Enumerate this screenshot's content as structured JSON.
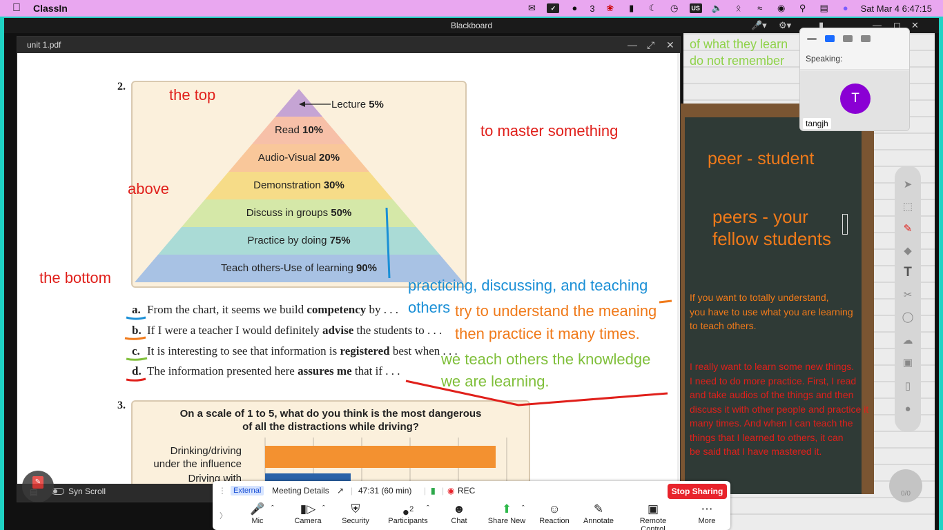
{
  "menubar": {
    "app_name": "ClassIn",
    "notifications_count": "3",
    "badge_count": "3",
    "input_source": "US",
    "datetime": "Sat Mar 4  6:47:15"
  },
  "window": {
    "title": "Blackboard"
  },
  "pdf": {
    "filename": "unit 1.pdf",
    "syn_scroll_label": "Syn Scroll",
    "q2_number": "2.",
    "q3_number": "3.",
    "pyramid_layers": [
      {
        "text": "Lecture ",
        "pct": "5%"
      },
      {
        "text": "Read ",
        "pct": "10%"
      },
      {
        "text": "Audio-Visual ",
        "pct": "20%"
      },
      {
        "text": "Demonstration ",
        "pct": "30%"
      },
      {
        "text": "Discuss in groups ",
        "pct": "50%"
      },
      {
        "text": "Practice by doing ",
        "pct": "75%"
      },
      {
        "text": "Teach others-Use of learning ",
        "pct": "90%"
      }
    ],
    "questions": [
      {
        "letter": "a.",
        "pre": "From the chart, it seems we build ",
        "bold": "competency",
        "post": " by . . ."
      },
      {
        "letter": "b.",
        "pre": "If I were a teacher I would definitely ",
        "bold": "advise",
        "post": " the students to . . ."
      },
      {
        "letter": "c.",
        "pre": "It is interesting to see that information is ",
        "bold": "registered",
        "post": " best when . . ."
      },
      {
        "letter": "d.",
        "pre": "The information presented here ",
        "bold": "assures me",
        "post": " that if . . ."
      }
    ],
    "chart": {
      "title_line1": "On a scale of 1 to 5, what do you think is the most dangerous",
      "title_line2": "of all the distractions while driving?",
      "cat1_line1": "Drinking/driving",
      "cat1_line2": "under the influence",
      "cat2_line1": "Driving with"
    },
    "annotations": {
      "the_top": "the top",
      "above": "above",
      "the_bottom": "the bottom",
      "to_master": "to master something",
      "practicing": "practicing, discussing, and teaching",
      "others": "others",
      "try_line1": "try to understand the meaning",
      "try_line2": "then practice it many times.",
      "we_teach_line1": "we teach others the knowledge",
      "we_teach_line2": "we are learning."
    }
  },
  "chart_data": {
    "type": "bar",
    "title": "On a scale of 1 to 5, what do you think is the most dangerous of all the distractions while driving?",
    "categories": [
      "Drinking/driving under the influence",
      "Driving with"
    ],
    "values": [
      5,
      2
    ],
    "xlim": [
      0,
      5
    ],
    "colors": [
      "#f39130",
      "#2a62a8"
    ]
  },
  "board": {
    "top_line1": "of what they learn",
    "top_line2": "do not remember",
    "peer": "peer - student",
    "peers_line1": "peers - your",
    "peers_line2": "fellow students",
    "para1": [
      "If you want to totally understand,",
      "you have to use what you are learning",
      "to teach others."
    ],
    "para2": [
      "I really want to learn some new things.",
      "I need to do more practice. First, I read",
      "and take audios of the things and then",
      "discuss it with other people and practice it",
      "many times. And when I can teach the",
      "things that I learned to others, it can",
      "be said that I have mastered it."
    ]
  },
  "speaking": {
    "label": "Speaking:",
    "avatar_letter": "T",
    "username": "tangjh"
  },
  "right_circle_label": "0/0",
  "zoom": {
    "external": "External",
    "meeting_details": "Meeting Details",
    "time": "47:31  (60 min)",
    "rec": "REC",
    "stop_sharing": "Stop Sharing",
    "participants_count": "2",
    "buttons": [
      "Mic",
      "Camera",
      "Security",
      "Participants",
      "Chat",
      "Share New",
      "Reaction",
      "Annotate",
      "Remote Control",
      "More"
    ]
  },
  "colors": {
    "menubar": "#e9a7f0",
    "teal_border": "#1fd3c4",
    "annotation_red": "#e0201b",
    "annotation_orange": "#f07a1a",
    "annotation_blue": "#1a8fd6",
    "annotation_green": "#7fbf3a",
    "stop_sharing": "#e8232b",
    "avatar": "#8a00d4"
  }
}
